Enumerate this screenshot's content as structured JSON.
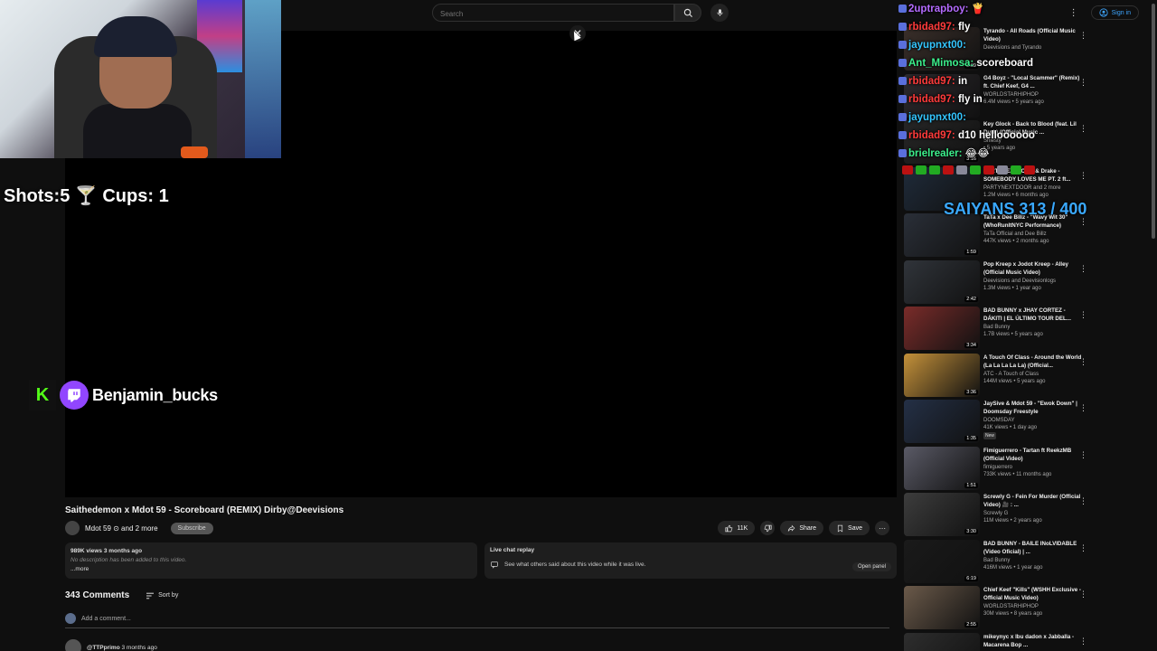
{
  "search": {
    "placeholder": "Search"
  },
  "header": {
    "signin_label": "Sign in"
  },
  "overlay": {
    "shots_label": "Shots:5 🍸 Cups: 1",
    "handle": "Benjamin_bucks",
    "kick_letter": "K"
  },
  "video": {
    "title": "Saithedemon x Mdot 59 - Scoreboard (REMIX) Dirby@Deevisions",
    "channel": "Mdot 59 ⊙ and 2 more",
    "subscribe_label": "Subscribe",
    "likes": "11K",
    "share_label": "Share",
    "save_label": "Save",
    "views_meta": "989K views  3 months ago",
    "no_description": "No description has been added to this video.",
    "more_label": "...more",
    "live_chat_title": "Live chat replay",
    "live_chat_text": "See what others said about this video while it was live.",
    "open_panel_label": "Open panel"
  },
  "comments": {
    "count": "343 Comments",
    "sort_label": "Sort by",
    "add_placeholder": "Add a comment...",
    "first_author": "@TTPprimo",
    "first_time": "3 months ago"
  },
  "chat": [
    {
      "user": "2uptrapboy:",
      "color": "#b46bff",
      "msg": "🍟"
    },
    {
      "user": "rbidad97:",
      "color": "#ff3b3b",
      "msg": "fly"
    },
    {
      "user": "jayupnxt00:",
      "color": "#34c6ff",
      "msg": ""
    },
    {
      "user": "Ant_Mimosa:",
      "color": "#3cf08c",
      "msg": "scoreboard"
    },
    {
      "user": "rbidad97:",
      "color": "#ff3b3b",
      "msg": "in"
    },
    {
      "user": "rbidad97:",
      "color": "#ff3b3b",
      "msg": "fly in"
    },
    {
      "user": "jayupnxt00:",
      "color": "#34c6ff",
      "msg": ""
    },
    {
      "user": "rbidad97:",
      "color": "#ff3b3b",
      "msg": "d10 helloooooo"
    },
    {
      "user": "brielrealer:",
      "color": "#3cf08c",
      "msg": "😂😂"
    }
  ],
  "saiyans": "SAIYANS 313 / 400",
  "recommendations": [
    {
      "title": "Tyrando - All Roads (Official Music Video)",
      "channel": "Deevisions and Tyrando",
      "views": "",
      "dur": "2:09",
      "color": "#3a2f2a"
    },
    {
      "title": "G4 Boyz - \"Local Scammer\" (Remix) ft. Chief Keef, G4 ...",
      "channel": "WORLDSTARHIPHOP",
      "views": "6.4M views • 5 years ago",
      "dur": "",
      "color": "#2d2a2e"
    },
    {
      "title": "Key Glock - Back to Blood (feat. Lil Durk) (Official Music ...",
      "channel": "Shiesty",
      "views": "• 5 years ago",
      "dur": "3:16",
      "color": "#262626"
    },
    {
      "title": "PARTYNEXTDOOR & Drake - SOMEBODY LOVES ME PT. 2 ft...",
      "channel": "PARTYNEXTDOOR and 2 more",
      "views": "1.2M views • 6 months ago",
      "dur": "",
      "color": "#1f2b3a"
    },
    {
      "title": "TaTa x Dee Billz - \"Wavy Wit 30\" (WhoRunItNYC Performance)",
      "channel": "TaTa Official and Dee Billz",
      "views": "447K views • 2 months ago",
      "dur": "1:59",
      "color": "#2a2f38"
    },
    {
      "title": "Pop Kreep x Jodot Kreep - Alley (Official Music Video)",
      "channel": "Deevisions and Deevisionlogs",
      "views": "1.3M views • 1 year ago",
      "dur": "2:42",
      "color": "#30343a"
    },
    {
      "title": "BAD BUNNY x JHAY CORTEZ - DÁKITI | EL ÚLTIMO TOUR DEL...",
      "channel": "Bad Bunny",
      "views": "1.7B views • 5 years ago",
      "dur": "3:34",
      "color": "#7a2c2a"
    },
    {
      "title": "A Touch Of Class - Around the World (La La La La La) (Official...",
      "channel": "ATC - A Touch of Class",
      "views": "144M views • 5 years ago",
      "dur": "3:36",
      "color": "#c4913a"
    },
    {
      "title": "JaySive & Mdot 59 - \"Ewok Down\" | Doomsday Freestyle",
      "channel": "DOOMSDAY",
      "views": "41K views • 1 day ago",
      "dur": "1:35",
      "new": "New",
      "color": "#243046"
    },
    {
      "title": "Fimiguerrero - Tartan ft ReekzMB (Official Video)",
      "channel": "fimiguerrero",
      "views": "733K views • 11 months ago",
      "dur": "1:51",
      "color": "#5a5a66"
    },
    {
      "title": "Screwly G - Fein For Murder (Official Video) 🎥 : ...",
      "channel": "Screwly G",
      "views": "11M views • 2 years ago",
      "dur": "3:30",
      "color": "#3d3d3d"
    },
    {
      "title": "BAD BUNNY - BAILE INoLVIDABLE (Video Oficial) | ...",
      "channel": "Bad Bunny",
      "views": "416M views • 1 year ago",
      "dur": "6:19",
      "color": "#1a1a1a"
    },
    {
      "title": "Chief Keef \"Kills\" (WSHH Exclusive - Official Music Video)",
      "channel": "WORLDSTARHIPHOP",
      "views": "30M views • 8 years ago",
      "dur": "2:55",
      "color": "#6b5a4a"
    },
    {
      "title": "mikeynyc x lbu dadon x Jabballa - Macarena Bop ...",
      "channel": "",
      "views": "",
      "dur": "",
      "color": "#2e2e2e"
    }
  ],
  "colors": {
    "accent": "#3ea6ff",
    "twitch": "#9146ff",
    "kick": "#53fc18",
    "saiyans": "#3aa9ff"
  }
}
